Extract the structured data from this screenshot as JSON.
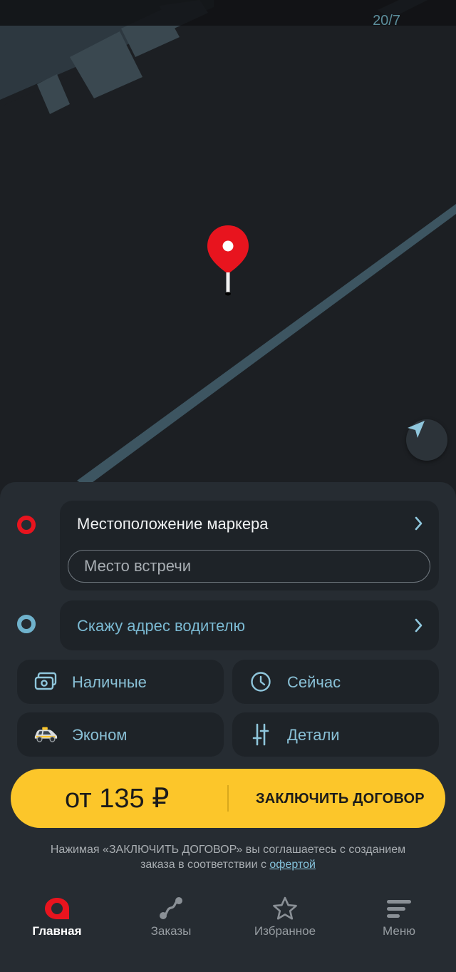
{
  "map": {
    "house_number": "20/7",
    "pin_icon": "map-pin-icon",
    "locate_icon": "navigation-arrow-icon"
  },
  "route": {
    "from": {
      "title": "Местоположение маркера",
      "meeting_placeholder": "Место встречи",
      "meeting_value": ""
    },
    "to": {
      "title": "Скажу адрес водителю"
    }
  },
  "options": {
    "payment": {
      "label": "Наличные",
      "icon": "cash-icon"
    },
    "time": {
      "label": "Сейчас",
      "icon": "clock-icon"
    },
    "tariff": {
      "label": "Эконом",
      "icon": "taxi-car-icon"
    },
    "details": {
      "label": "Детали",
      "icon": "sliders-icon"
    }
  },
  "order": {
    "price": "от 135 ₽",
    "action": "ЗАКЛЮЧИТЬ ДОГОВОР"
  },
  "disclaimer": {
    "text_line1": "Нажимая «ЗАКЛЮЧИТЬ ДОГОВОР» вы соглашаетесь с созданием",
    "text_line2": "заказа в соответствии с ",
    "link": "офертой"
  },
  "tabs": [
    {
      "label": "Главная",
      "icon": "home-logo-icon",
      "active": true
    },
    {
      "label": "Заказы",
      "icon": "route-icon",
      "active": false
    },
    {
      "label": "Избранное",
      "icon": "star-icon",
      "active": false
    },
    {
      "label": "Меню",
      "icon": "menu-icon",
      "active": false
    }
  ],
  "colors": {
    "accent_yellow": "#fcc62a",
    "from_red": "#e8141e",
    "to_blue": "#6fb2cc",
    "link_blue": "#86c4dd"
  }
}
